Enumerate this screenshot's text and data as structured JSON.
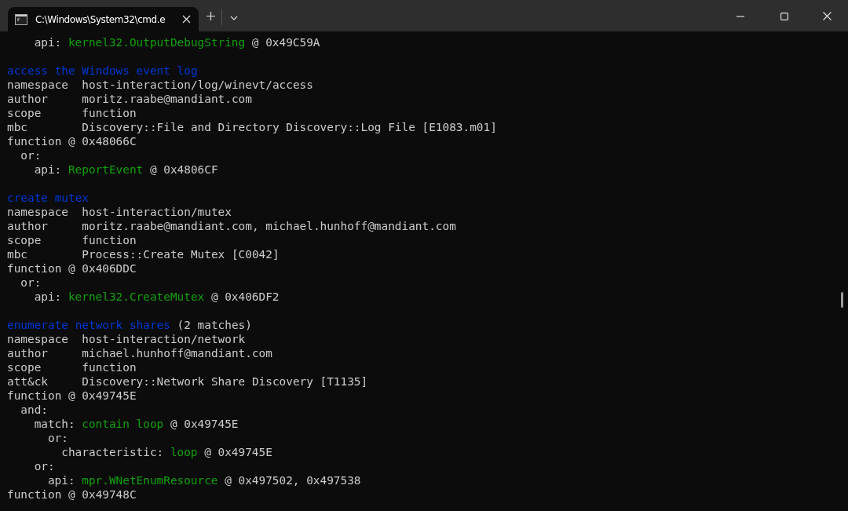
{
  "window": {
    "tab": {
      "title": "C:\\Windows\\System32\\cmd.e",
      "selected": true
    }
  },
  "terminal": {
    "blocks": [
      {
        "lines": [
          {
            "children": [
              {
                "children": [
                  {
                    "segments": [
                      {
                        "kind": "plain",
                        "text": "api:"
                      },
                      {
                        "kind": "feature",
                        "text": "kernel32.OutputDebugString"
                      },
                      {
                        "kind": "plain",
                        "text": "@ 0x49C59A"
                      }
                    ]
                  }
                ]
              }
            ]
          }
        ]
      },
      {
        "lines": [
          {
            "segments": [
              {
                "kind": "rule",
                "text": "access the Windows event log"
              }
            ]
          },
          {
            "segments": [
              {
                "kind": "plain",
                "text": "namespace  host-interaction/log/winevt/access"
              }
            ]
          },
          {
            "segments": [
              {
                "kind": "plain",
                "text": "author     moritz.raabe@mandiant.com"
              }
            ]
          },
          {
            "segments": [
              {
                "kind": "plain",
                "text": "scope      function"
              }
            ]
          },
          {
            "segments": [
              {
                "kind": "plain",
                "text": "mbc        Discovery::File and Directory Discovery::Log File [E1083.m01]"
              }
            ]
          },
          {
            "segments": [
              {
                "kind": "plain",
                "text": "function @ 0x48066C"
              }
            ],
            "children": [
              {
                "segments": [
                  {
                    "kind": "plain",
                    "text": "or:"
                  }
                ],
                "children": [
                  {
                    "segments": [
                      {
                        "kind": "plain",
                        "text": "api:"
                      },
                      {
                        "kind": "feature",
                        "text": "ReportEvent"
                      },
                      {
                        "kind": "plain",
                        "text": "@ 0x4806CF"
                      }
                    ]
                  }
                ]
              }
            ]
          }
        ]
      },
      {
        "lines": [
          {
            "segments": [
              {
                "kind": "rule",
                "text": "create mutex"
              }
            ]
          },
          {
            "segments": [
              {
                "kind": "plain",
                "text": "namespace  host-interaction/mutex"
              }
            ]
          },
          {
            "segments": [
              {
                "kind": "plain",
                "text": "author     moritz.raabe@mandiant.com, michael.hunhoff@mandiant.com"
              }
            ]
          },
          {
            "segments": [
              {
                "kind": "plain",
                "text": "scope      function"
              }
            ]
          },
          {
            "segments": [
              {
                "kind": "plain",
                "text": "mbc        Process::Create Mutex [C0042]"
              }
            ]
          },
          {
            "segments": [
              {
                "kind": "plain",
                "text": "function @ 0x406DDC"
              }
            ],
            "children": [
              {
                "segments": [
                  {
                    "kind": "plain",
                    "text": "or:"
                  }
                ],
                "children": [
                  {
                    "segments": [
                      {
                        "kind": "plain",
                        "text": "api:"
                      },
                      {
                        "kind": "feature",
                        "text": "kernel32.CreateMutex"
                      },
                      {
                        "kind": "plain",
                        "text": "@ 0x406DF2"
                      }
                    ]
                  }
                ]
              }
            ]
          }
        ]
      },
      {
        "lines": [
          {
            "segments": [
              {
                "kind": "rule",
                "text": "enumerate network shares"
              },
              {
                "kind": "plain",
                "text": "(2 matches)"
              }
            ]
          },
          {
            "segments": [
              {
                "kind": "plain",
                "text": "namespace  host-interaction/network"
              }
            ]
          },
          {
            "segments": [
              {
                "kind": "plain",
                "text": "author     michael.hunhoff@mandiant.com"
              }
            ]
          },
          {
            "segments": [
              {
                "kind": "plain",
                "text": "scope      function"
              }
            ]
          },
          {
            "segments": [
              {
                "kind": "plain",
                "text": "att&ck     Discovery::Network Share Discovery [T1135]"
              }
            ]
          },
          {
            "segments": [
              {
                "kind": "plain",
                "text": "function @ 0x49745E"
              }
            ],
            "children": [
              {
                "segments": [
                  {
                    "kind": "plain",
                    "text": "and:"
                  }
                ],
                "children": [
                  {
                    "segments": [
                      {
                        "kind": "plain",
                        "text": "match:"
                      },
                      {
                        "kind": "feature",
                        "text": "contain loop"
                      },
                      {
                        "kind": "plain",
                        "text": "@ 0x49745E"
                      }
                    ],
                    "children": [
                      {
                        "segments": [
                          {
                            "kind": "plain",
                            "text": "or:"
                          }
                        ],
                        "children": [
                          {
                            "segments": [
                              {
                                "kind": "plain",
                                "text": "characteristic:"
                              },
                              {
                                "kind": "feature",
                                "text": "loop"
                              },
                              {
                                "kind": "plain",
                                "text": "@ 0x49745E"
                              }
                            ]
                          }
                        ]
                      }
                    ]
                  },
                  {
                    "segments": [
                      {
                        "kind": "plain",
                        "text": "or:"
                      }
                    ],
                    "children": [
                      {
                        "segments": [
                          {
                            "kind": "plain",
                            "text": "api:"
                          },
                          {
                            "kind": "feature",
                            "text": "mpr.WNetEnumResource"
                          },
                          {
                            "kind": "plain",
                            "text": "@ 0x497502, 0x497538"
                          }
                        ]
                      }
                    ]
                  }
                ]
              }
            ]
          },
          {
            "segments": [
              {
                "kind": "plain",
                "text": "function @ 0x49748C"
              }
            ]
          }
        ]
      }
    ]
  }
}
